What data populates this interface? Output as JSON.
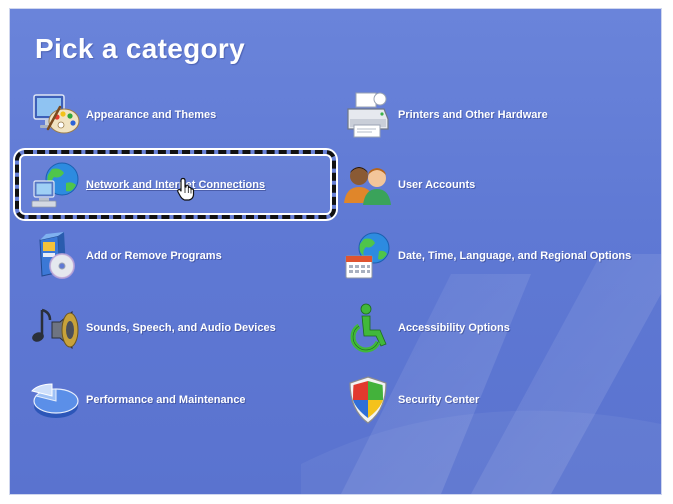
{
  "page": {
    "title": "Pick a category"
  },
  "categories": [
    {
      "label": "Appearance and Themes",
      "icon": "appearance-themes-icon"
    },
    {
      "label": "Printers and Other Hardware",
      "icon": "printer-icon"
    },
    {
      "label": "Network and Internet Connections",
      "icon": "network-globe-icon",
      "state": "hovered"
    },
    {
      "label": "User Accounts",
      "icon": "user-accounts-icon"
    },
    {
      "label": "Add or Remove Programs",
      "icon": "add-remove-programs-icon"
    },
    {
      "label": "Date, Time, Language, and Regional Options",
      "icon": "date-time-globe-icon"
    },
    {
      "label": "Sounds, Speech, and Audio Devices",
      "icon": "speaker-note-icon"
    },
    {
      "label": "Accessibility Options",
      "icon": "accessibility-icon"
    },
    {
      "label": "Performance and Maintenance",
      "icon": "pie-chart-icon"
    },
    {
      "label": "Security Center",
      "icon": "security-shield-icon"
    }
  ],
  "colors": {
    "panel_background": "#6a84da",
    "text": "#ffffff",
    "focus_border": "#111111"
  },
  "cursor": {
    "icon": "hand-pointer-icon"
  }
}
